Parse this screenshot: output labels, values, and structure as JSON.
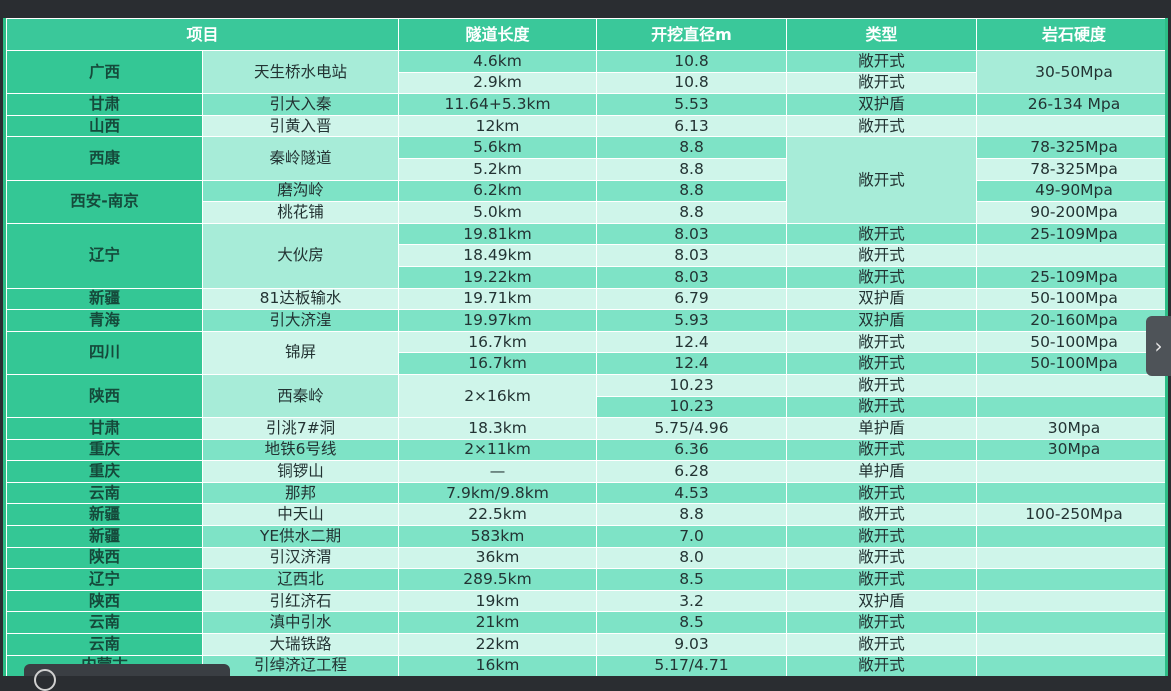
{
  "table": {
    "headers": [
      "项目",
      "隧道长度",
      "开挖直径m",
      "类型",
      "岩石硬度"
    ],
    "rows": [
      {
        "prov": "广西",
        "name": "天生桥水电站",
        "len": "4.6km",
        "dia": "10.8",
        "type": "敞开式",
        "rock": "30-50Mpa"
      },
      {
        "len": "2.9km",
        "dia": "10.8",
        "type": "敞开式"
      },
      {
        "prov": "甘肃",
        "name": "引大入秦",
        "len": "11.64+5.3km",
        "dia": "5.53",
        "type": "双护盾",
        "rock": "26-134 Mpa"
      },
      {
        "prov": "山西",
        "name": "引黄入晋",
        "len": "12km",
        "dia": "6.13",
        "type": "敞开式",
        "rock": ""
      },
      {
        "prov": "西康",
        "name": "秦岭隧道",
        "len": "5.6km",
        "dia": "8.8",
        "type": "敞开式",
        "rock": "78-325Mpa"
      },
      {
        "len": "5.2km",
        "dia": "8.8",
        "rock": "78-325Mpa"
      },
      {
        "prov": "西安-南京",
        "name": "磨沟岭",
        "len": "6.2km",
        "dia": "8.8",
        "rock": "49-90Mpa"
      },
      {
        "name": "桃花铺",
        "len": "5.0km",
        "dia": "8.8",
        "rock": "90-200Mpa"
      },
      {
        "prov": "辽宁",
        "name": "大伙房",
        "len": "19.81km",
        "dia": "8.03",
        "type": "敞开式",
        "rock": "25-109Mpa"
      },
      {
        "len": "18.49km",
        "dia": "8.03",
        "type": "敞开式",
        "rock": ""
      },
      {
        "len": "19.22km",
        "dia": "8.03",
        "type": "敞开式",
        "rock": "25-109Mpa"
      },
      {
        "prov": "新疆",
        "name": "81达板输水",
        "len": "19.71km",
        "dia": "6.79",
        "type": "双护盾",
        "rock": "50-100Mpa"
      },
      {
        "prov": "青海",
        "name": "引大济湟",
        "len": "19.97km",
        "dia": "5.93",
        "type": "双护盾",
        "rock": "20-160Mpa"
      },
      {
        "prov": "四川",
        "name": "锦屏",
        "len": "16.7km",
        "dia": "12.4",
        "type": "敞开式",
        "rock": "50-100Mpa"
      },
      {
        "len": "16.7km",
        "dia": "12.4",
        "type": "敞开式",
        "rock": "50-100Mpa"
      },
      {
        "prov": "陕西",
        "name": "西秦岭",
        "len": "2×16km",
        "dia": "10.23",
        "type": "敞开式",
        "rock": ""
      },
      {
        "dia": "10.23",
        "type": "敞开式",
        "rock": ""
      },
      {
        "prov": "甘肃",
        "name": "引洮7#洞",
        "len": "18.3km",
        "dia": "5.75/4.96",
        "type": "单护盾",
        "rock": "30Mpa"
      },
      {
        "prov": "重庆",
        "name": "地铁6号线",
        "len": "2×11km",
        "dia": "6.36",
        "type": "敞开式",
        "rock": "30Mpa"
      },
      {
        "prov": "重庆",
        "name": "铜锣山",
        "len": "—",
        "dia": "6.28",
        "type": "单护盾",
        "rock": ""
      },
      {
        "prov": "云南",
        "name": "那邦",
        "len": "7.9km/9.8km",
        "dia": "4.53",
        "type": "敞开式",
        "rock": ""
      },
      {
        "prov": "新疆",
        "name": "中天山",
        "len": "22.5km",
        "dia": "8.8",
        "type": "敞开式",
        "rock": "100-250Mpa"
      },
      {
        "prov": "新疆",
        "name": "YE供水二期",
        "len": "583km",
        "dia": "7.0",
        "type": "敞开式",
        "rock": ""
      },
      {
        "prov": "陕西",
        "name": "引汉济渭",
        "len": "36km",
        "dia": "8.0",
        "type": "敞开式",
        "rock": ""
      },
      {
        "prov": "辽宁",
        "name": "辽西北",
        "len": "289.5km",
        "dia": "8.5",
        "type": "敞开式",
        "rock": ""
      },
      {
        "prov": "陕西",
        "name": "引红济石",
        "len": "19km",
        "dia": "3.2",
        "type": "双护盾",
        "rock": ""
      },
      {
        "prov": "云南",
        "name": "滇中引水",
        "len": "21km",
        "dia": "8.5",
        "type": "敞开式",
        "rock": ""
      },
      {
        "prov": "云南",
        "name": "大瑞铁路",
        "len": "22km",
        "dia": "9.03",
        "type": "敞开式",
        "rock": ""
      },
      {
        "prov": "内蒙古",
        "name": "引绰济辽工程",
        "len": "16km",
        "dia": "5.17/4.71",
        "type": "敞开式",
        "rock": ""
      }
    ]
  },
  "nav": {
    "next_icon": "›"
  },
  "colors": {
    "header": "#3ac89a",
    "province": "#34c795",
    "dark_row": "#7ee3c6",
    "light_row": "#cff5ea",
    "frame": "#2dbd86"
  }
}
